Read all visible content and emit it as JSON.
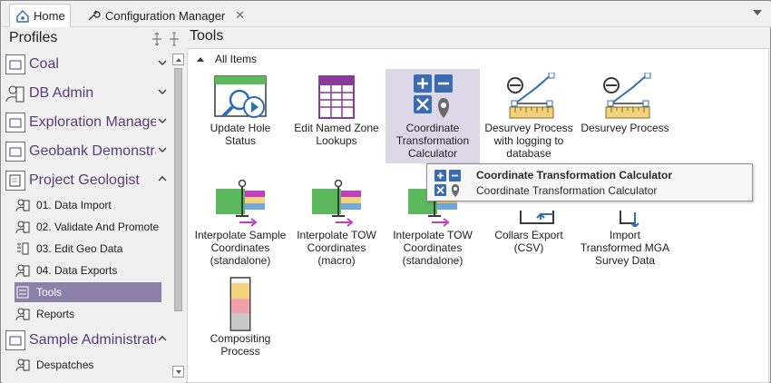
{
  "tabs": {
    "home_label": "Home",
    "config_label": "Configuration Manager",
    "close_glyph": "✕"
  },
  "left_panel": {
    "title": "Profiles",
    "profiles": [
      {
        "label": "Coal",
        "icon": "folder-profile-icon",
        "expanded": false
      },
      {
        "label": "DB Admin",
        "icon": "user-profile-icon",
        "expanded": false
      },
      {
        "label": "Exploration Manager",
        "icon": "folder-profile-icon",
        "expanded": false
      },
      {
        "label": "Geobank Demonstration",
        "icon": "folder-profile-icon",
        "expanded": false
      },
      {
        "label": "Project Geologist",
        "icon": "clipboard-profile-icon",
        "expanded": true
      },
      {
        "label": "Sample Administrator",
        "icon": "folder-profile-icon",
        "expanded": true
      }
    ],
    "project_geologist_items": [
      {
        "label": "01. Data Import",
        "icon": "user-doc-icon"
      },
      {
        "label": "02. Validate And Promote",
        "icon": "user-doc-icon"
      },
      {
        "label": "03. Edit Geo Data",
        "icon": "edit-data-icon"
      },
      {
        "label": "04. Data Exports",
        "icon": "user-doc-icon"
      },
      {
        "label": "Tools",
        "icon": "tools-icon",
        "selected": true
      },
      {
        "label": "Reports",
        "icon": "user-doc-icon"
      }
    ],
    "sample_admin_items": [
      {
        "label": "Despatches",
        "icon": "user-doc-icon"
      }
    ]
  },
  "right_panel": {
    "title": "Tools",
    "group": "All Items",
    "tiles": [
      {
        "label": "Update Hole Status",
        "icon": "update-hole-status-icon"
      },
      {
        "label": "Edit Named Zone Lookups",
        "icon": "table-grid-icon"
      },
      {
        "label": "Coordinate Transformation Calculator",
        "icon": "calculator-pin-icon",
        "highlighted": true
      },
      {
        "label": "Desurvey Process with logging to database",
        "icon": "desurvey-icon"
      },
      {
        "label": "Desurvey Process",
        "icon": "desurvey-icon"
      },
      {
        "label": "Interpolate Sample Coordinates (standalone)",
        "icon": "interpolate-icon"
      },
      {
        "label": "Interpolate TOW Coordinates (macro)",
        "icon": "interpolate-icon"
      },
      {
        "label": "Interpolate TOW Coordinates (standalone)",
        "icon": "interpolate-icon"
      },
      {
        "label": "Collars Export (CSV)",
        "icon": "export-icon"
      },
      {
        "label": "Import Transformed MGA Survey Data",
        "icon": "import-icon"
      },
      {
        "label": "Compositing Process",
        "icon": "compositing-icon"
      }
    ]
  },
  "tooltip": {
    "title": "Coordinate Transformation Calculator",
    "description": "Coordinate Transformation Calculator"
  },
  "colors": {
    "accent_purple": "#8c7fa8",
    "highlight": "#dcd8e8",
    "calc_blue": "#3b6bb0",
    "desurvey_yellow": "#f2d27a",
    "green": "#5cb85c",
    "magenta": "#c040c0"
  }
}
